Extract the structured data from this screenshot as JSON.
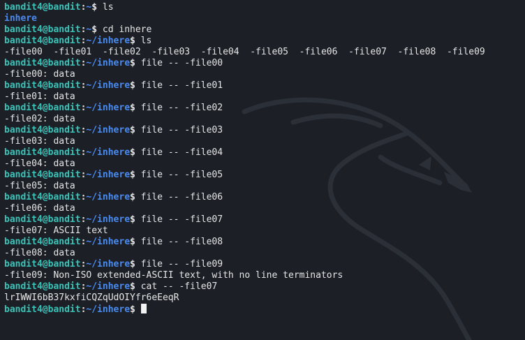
{
  "prompt": {
    "user_host": "bandit4@bandit",
    "home_path": "~",
    "inhere_path": "~/inhere",
    "dollar": "$"
  },
  "lines": [
    {
      "type": "prompt",
      "path": "~",
      "cmd": " ls"
    },
    {
      "type": "dir",
      "text": "inhere"
    },
    {
      "type": "prompt",
      "path": "~",
      "cmd": " cd inhere"
    },
    {
      "type": "prompt",
      "path": "~/inhere",
      "cmd": " ls"
    },
    {
      "type": "output",
      "text": "-file00  -file01  -file02  -file03  -file04  -file05  -file06  -file07  -file08  -file09"
    },
    {
      "type": "prompt",
      "path": "~/inhere",
      "cmd": " file -- -file00"
    },
    {
      "type": "output",
      "text": "-file00: data"
    },
    {
      "type": "prompt",
      "path": "~/inhere",
      "cmd": " file -- -file01"
    },
    {
      "type": "output",
      "text": "-file01: data"
    },
    {
      "type": "prompt",
      "path": "~/inhere",
      "cmd": " file -- -file02"
    },
    {
      "type": "output",
      "text": "-file02: data"
    },
    {
      "type": "prompt",
      "path": "~/inhere",
      "cmd": " file -- -file03"
    },
    {
      "type": "output",
      "text": "-file03: data"
    },
    {
      "type": "prompt",
      "path": "~/inhere",
      "cmd": " file -- -file04"
    },
    {
      "type": "output",
      "text": "-file04: data"
    },
    {
      "type": "prompt",
      "path": "~/inhere",
      "cmd": " file -- -file05"
    },
    {
      "type": "output",
      "text": "-file05: data"
    },
    {
      "type": "prompt",
      "path": "~/inhere",
      "cmd": " file -- -file06"
    },
    {
      "type": "output",
      "text": "-file06: data"
    },
    {
      "type": "prompt",
      "path": "~/inhere",
      "cmd": " file -- -file07"
    },
    {
      "type": "output",
      "text": "-file07: ASCII text"
    },
    {
      "type": "prompt",
      "path": "~/inhere",
      "cmd": " file -- -file08"
    },
    {
      "type": "output",
      "text": "-file08: data"
    },
    {
      "type": "prompt",
      "path": "~/inhere",
      "cmd": " file -- -file09"
    },
    {
      "type": "output",
      "text": "-file09: Non-ISO extended-ASCII text, with no line terminators"
    },
    {
      "type": "prompt",
      "path": "~/inhere",
      "cmd": " cat -- -file07"
    },
    {
      "type": "output",
      "text": "lrIWWI6bB37kxfiCQZqUdOIYfr6eEeqR"
    },
    {
      "type": "prompt",
      "path": "~/inhere",
      "cmd": " ",
      "cursor": true
    }
  ],
  "colors": {
    "background": "#1c1f26",
    "user_host": "#3ac3b8",
    "path": "#4a8bf0",
    "text": "#e6e6e6"
  },
  "icons": {
    "background_logo": "kali-dragon-icon"
  }
}
